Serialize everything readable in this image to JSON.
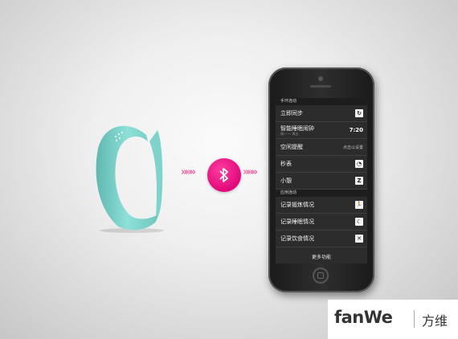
{
  "colors": {
    "band": "#7fd3cb",
    "bluetooth": "#e0087a",
    "arrow": "#ef6aa8",
    "screen": "#2c2c2c"
  },
  "connector": {
    "left_arrows": "»»»",
    "right_arrows": "»»»",
    "icon": "bluetooth-icon"
  },
  "phone": {
    "section_1": "手环连动",
    "items_1": [
      {
        "label": "立即同步",
        "icon": "sync-icon",
        "glyph": "↻"
      },
      {
        "label": "智能睡眠闹钟",
        "sub": "周一 ～ 周五",
        "value": "7:20"
      },
      {
        "label": "空闲提醒",
        "link": "点击以设置"
      },
      {
        "label": "秒表",
        "icon": "stopwatch-icon",
        "glyph": "◔"
      },
      {
        "label": "小憩",
        "icon": "nap-icon",
        "glyph": "Z"
      }
    ],
    "section_2": "应用连动",
    "items_2": [
      {
        "label": "记录锻炼情况",
        "icon": "run-icon",
        "glyph": "🏃"
      },
      {
        "label": "记录睡眠情况",
        "icon": "moon-icon",
        "glyph": "☾"
      },
      {
        "label": "记录饮食情况",
        "icon": "cutlery-icon",
        "glyph": "✕"
      }
    ],
    "more": "更多功能"
  },
  "logo": {
    "en": "fanWe",
    "cn": "方维"
  }
}
